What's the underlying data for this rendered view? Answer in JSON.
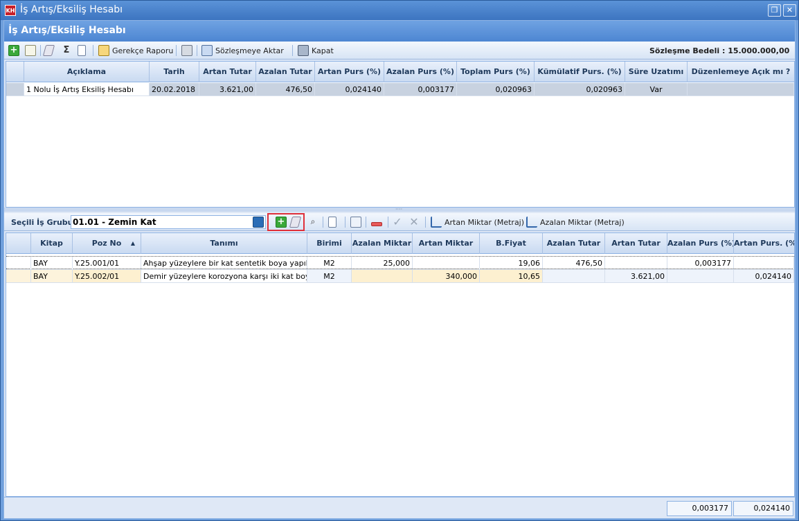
{
  "window": {
    "title": "İş Artış/Eksiliş Hesabı",
    "app_badge": "KH",
    "restore_icon": "restore-icon",
    "close_icon": "close-icon"
  },
  "form": {
    "header": "İş Artış/Eksiliş Hesabı"
  },
  "top_toolbar": {
    "buttons": [
      {
        "icon": "add-icon"
      },
      {
        "icon": "edit-icon"
      },
      {
        "icon": "eraser-icon"
      },
      {
        "icon": "sigma-icon",
        "glyph": "Σ"
      },
      {
        "icon": "document-icon"
      }
    ],
    "gerekce_label": "Gerekçe Raporu",
    "print_icon": "print-icon",
    "aktar_label": "Sözleşmeye Aktar",
    "kapat_label": "Kapat",
    "contract_value": "Sözleşme Bedeli : 15.000.000,00"
  },
  "top_grid": {
    "columns": [
      "Açıklama",
      "Tarih",
      "Artan Tutar",
      "Azalan Tutar",
      "Artan Purs (%)",
      "Azalan Purs (%)",
      "Toplam Purs (%)",
      "Kümülatif Purs. (%)",
      "Süre Uzatımı",
      "Düzenlemeye Açık mı ?"
    ],
    "rows": [
      [
        "1 Nolu İş Artış Eksiliş Hesabı",
        "20.02.2018",
        "3.621,00",
        "476,50",
        "0,024140",
        "0,003177",
        "0,020963",
        "0,020963",
        "Var",
        ""
      ]
    ]
  },
  "bottom_toolbar": {
    "group_label": "Seçili İş Grubu",
    "group_value": "01.01 - Zemin Kat",
    "artan_metraj_label": "Artan Miktar (Metraj)",
    "azalan_metraj_label": "Azalan Miktar (Metraj)",
    "binoculars_glyph": "⌕",
    "check_glyph": "✓",
    "cancel_glyph": "✕"
  },
  "bottom_grid": {
    "columns": [
      "Kitap",
      "Poz No",
      "Tanımı",
      "Birimi",
      "Azalan Miktar",
      "Artan Miktar",
      "B.Fiyat",
      "Azalan Tutar",
      "Artan Tutar",
      "Azalan Purs (%)",
      "Artan Purs. (%)"
    ],
    "sort_indicator": "▲",
    "rows": [
      [
        "BAY",
        "Y.25.001/01",
        "Ahşap yüzeylere bir kat sentetik boya yapılm",
        "M2",
        "25,000",
        "",
        "19,06",
        "476,50",
        "",
        "0,003177",
        ""
      ],
      [
        "BAY",
        "Y.25.002/01",
        "Demir yüzeylere korozyona karşı iki kat boya",
        "M2",
        "",
        "340,000",
        "10,65",
        "",
        "3.621,00",
        "",
        "0,024140"
      ]
    ]
  },
  "footer": {
    "azalan_purs_total": "0,003177",
    "artan_purs_total": "0,024140"
  }
}
